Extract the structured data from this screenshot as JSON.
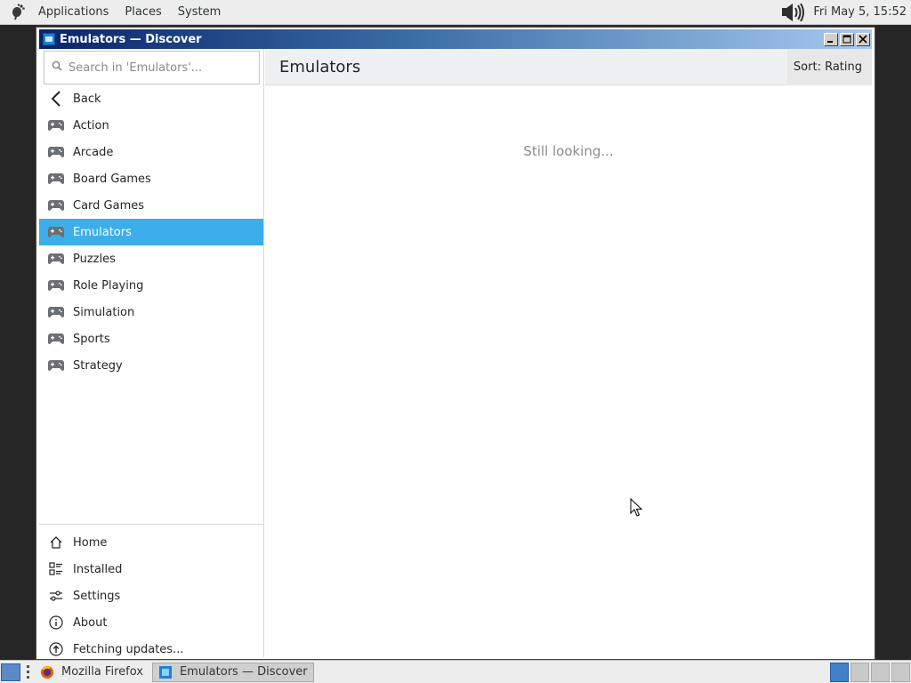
{
  "top_panel": {
    "menus": [
      "Applications",
      "Places",
      "System"
    ],
    "clock": "Fri May  5, 15:52",
    "icons": {
      "logo": "gnome-foot-icon",
      "volume": "volume-icon"
    }
  },
  "window": {
    "title": "Emulators — Discover",
    "buttons": [
      "minimize",
      "maximize",
      "close"
    ]
  },
  "sidebar": {
    "search_placeholder": "Search in 'Emulators'...",
    "back_label": "Back",
    "categories": [
      {
        "label": "Action",
        "icon": "gamepad-icon",
        "selected": false
      },
      {
        "label": "Arcade",
        "icon": "gamepad-icon",
        "selected": false
      },
      {
        "label": "Board Games",
        "icon": "gamepad-icon",
        "selected": false
      },
      {
        "label": "Card Games",
        "icon": "gamepad-icon",
        "selected": false
      },
      {
        "label": "Emulators",
        "icon": "gamepad-icon",
        "selected": true
      },
      {
        "label": "Puzzles",
        "icon": "gamepad-icon",
        "selected": false
      },
      {
        "label": "Role Playing",
        "icon": "gamepad-icon",
        "selected": false
      },
      {
        "label": "Simulation",
        "icon": "gamepad-icon",
        "selected": false
      },
      {
        "label": "Sports",
        "icon": "gamepad-icon",
        "selected": false
      },
      {
        "label": "Strategy",
        "icon": "gamepad-icon",
        "selected": false
      }
    ],
    "bottom": [
      {
        "label": "Home",
        "icon": "home-icon"
      },
      {
        "label": "Installed",
        "icon": "installed-list-icon"
      },
      {
        "label": "Settings",
        "icon": "settings-sliders-icon"
      },
      {
        "label": "About",
        "icon": "info-icon"
      },
      {
        "label": "Fetching updates...",
        "icon": "update-arrow-icon"
      }
    ]
  },
  "main": {
    "title": "Emulators",
    "sort_label": "Sort: Rating",
    "status": "Still looking..."
  },
  "taskbar": {
    "tasks": [
      {
        "label": "Mozilla Firefox",
        "icon": "firefox-icon",
        "active": false
      },
      {
        "label": "Emulators — Discover",
        "icon": "discover-icon",
        "active": true
      }
    ],
    "workspaces": 4,
    "current_workspace": 1
  },
  "colors": {
    "selection": "#3daee9",
    "header_bg": "#eff0f1",
    "titlebar_start": "#0a246a",
    "titlebar_end": "#a6caf0"
  }
}
